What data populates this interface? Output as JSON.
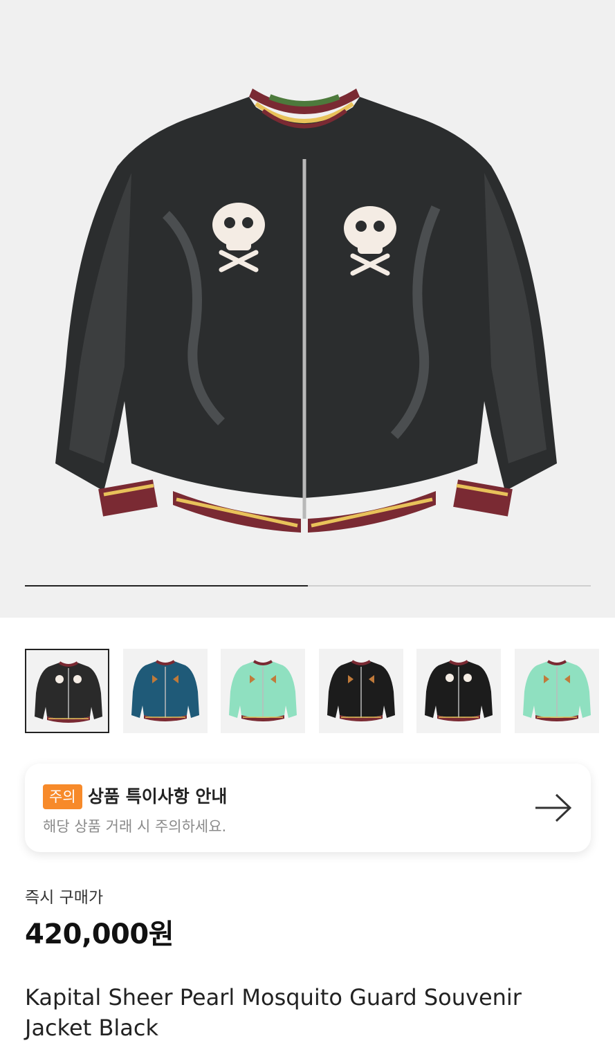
{
  "gallery": {
    "progress": 0.5,
    "main_image": "Black sheer souvenir jacket with skull embroidery",
    "thumbnails": [
      {
        "jacket": "#2a2a2a",
        "embroidery": "skull",
        "selected": true
      },
      {
        "jacket": "#1f5a78",
        "embroidery": "bird",
        "selected": false
      },
      {
        "jacket": "#8fe0c0",
        "embroidery": "bird",
        "selected": false
      },
      {
        "jacket": "#1c1c1c",
        "embroidery": "bird",
        "selected": false
      },
      {
        "jacket": "#1c1c1c",
        "embroidery": "skull",
        "selected": false
      },
      {
        "jacket": "#8fe0c0",
        "embroidery": "bird",
        "selected": false
      }
    ]
  },
  "notice": {
    "badge": "주의",
    "title": "상품 특이사항 안내",
    "subtitle": "해당 상품 거래 시 주의하세요.",
    "arrow_icon": "arrow-right-icon",
    "badge_color": "#f78a2a"
  },
  "price": {
    "label": "즉시 구매가",
    "value": "420,000원"
  },
  "product": {
    "title": "Kapital Sheer Pearl Mosquito Guard Souvenir Jacket Black"
  }
}
